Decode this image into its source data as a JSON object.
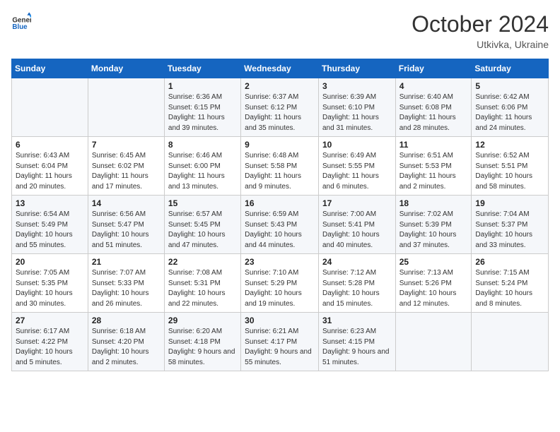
{
  "header": {
    "logo_general": "General",
    "logo_blue": "Blue",
    "month": "October 2024",
    "location": "Utkivka, Ukraine"
  },
  "days_of_week": [
    "Sunday",
    "Monday",
    "Tuesday",
    "Wednesday",
    "Thursday",
    "Friday",
    "Saturday"
  ],
  "weeks": [
    [
      {
        "day": "",
        "info": ""
      },
      {
        "day": "",
        "info": ""
      },
      {
        "day": "1",
        "info": "Sunrise: 6:36 AM\nSunset: 6:15 PM\nDaylight: 11 hours and 39 minutes."
      },
      {
        "day": "2",
        "info": "Sunrise: 6:37 AM\nSunset: 6:12 PM\nDaylight: 11 hours and 35 minutes."
      },
      {
        "day": "3",
        "info": "Sunrise: 6:39 AM\nSunset: 6:10 PM\nDaylight: 11 hours and 31 minutes."
      },
      {
        "day": "4",
        "info": "Sunrise: 6:40 AM\nSunset: 6:08 PM\nDaylight: 11 hours and 28 minutes."
      },
      {
        "day": "5",
        "info": "Sunrise: 6:42 AM\nSunset: 6:06 PM\nDaylight: 11 hours and 24 minutes."
      }
    ],
    [
      {
        "day": "6",
        "info": "Sunrise: 6:43 AM\nSunset: 6:04 PM\nDaylight: 11 hours and 20 minutes."
      },
      {
        "day": "7",
        "info": "Sunrise: 6:45 AM\nSunset: 6:02 PM\nDaylight: 11 hours and 17 minutes."
      },
      {
        "day": "8",
        "info": "Sunrise: 6:46 AM\nSunset: 6:00 PM\nDaylight: 11 hours and 13 minutes."
      },
      {
        "day": "9",
        "info": "Sunrise: 6:48 AM\nSunset: 5:58 PM\nDaylight: 11 hours and 9 minutes."
      },
      {
        "day": "10",
        "info": "Sunrise: 6:49 AM\nSunset: 5:55 PM\nDaylight: 11 hours and 6 minutes."
      },
      {
        "day": "11",
        "info": "Sunrise: 6:51 AM\nSunset: 5:53 PM\nDaylight: 11 hours and 2 minutes."
      },
      {
        "day": "12",
        "info": "Sunrise: 6:52 AM\nSunset: 5:51 PM\nDaylight: 10 hours and 58 minutes."
      }
    ],
    [
      {
        "day": "13",
        "info": "Sunrise: 6:54 AM\nSunset: 5:49 PM\nDaylight: 10 hours and 55 minutes."
      },
      {
        "day": "14",
        "info": "Sunrise: 6:56 AM\nSunset: 5:47 PM\nDaylight: 10 hours and 51 minutes."
      },
      {
        "day": "15",
        "info": "Sunrise: 6:57 AM\nSunset: 5:45 PM\nDaylight: 10 hours and 47 minutes."
      },
      {
        "day": "16",
        "info": "Sunrise: 6:59 AM\nSunset: 5:43 PM\nDaylight: 10 hours and 44 minutes."
      },
      {
        "day": "17",
        "info": "Sunrise: 7:00 AM\nSunset: 5:41 PM\nDaylight: 10 hours and 40 minutes."
      },
      {
        "day": "18",
        "info": "Sunrise: 7:02 AM\nSunset: 5:39 PM\nDaylight: 10 hours and 37 minutes."
      },
      {
        "day": "19",
        "info": "Sunrise: 7:04 AM\nSunset: 5:37 PM\nDaylight: 10 hours and 33 minutes."
      }
    ],
    [
      {
        "day": "20",
        "info": "Sunrise: 7:05 AM\nSunset: 5:35 PM\nDaylight: 10 hours and 30 minutes."
      },
      {
        "day": "21",
        "info": "Sunrise: 7:07 AM\nSunset: 5:33 PM\nDaylight: 10 hours and 26 minutes."
      },
      {
        "day": "22",
        "info": "Sunrise: 7:08 AM\nSunset: 5:31 PM\nDaylight: 10 hours and 22 minutes."
      },
      {
        "day": "23",
        "info": "Sunrise: 7:10 AM\nSunset: 5:29 PM\nDaylight: 10 hours and 19 minutes."
      },
      {
        "day": "24",
        "info": "Sunrise: 7:12 AM\nSunset: 5:28 PM\nDaylight: 10 hours and 15 minutes."
      },
      {
        "day": "25",
        "info": "Sunrise: 7:13 AM\nSunset: 5:26 PM\nDaylight: 10 hours and 12 minutes."
      },
      {
        "day": "26",
        "info": "Sunrise: 7:15 AM\nSunset: 5:24 PM\nDaylight: 10 hours and 8 minutes."
      }
    ],
    [
      {
        "day": "27",
        "info": "Sunrise: 6:17 AM\nSunset: 4:22 PM\nDaylight: 10 hours and 5 minutes."
      },
      {
        "day": "28",
        "info": "Sunrise: 6:18 AM\nSunset: 4:20 PM\nDaylight: 10 hours and 2 minutes."
      },
      {
        "day": "29",
        "info": "Sunrise: 6:20 AM\nSunset: 4:18 PM\nDaylight: 9 hours and 58 minutes."
      },
      {
        "day": "30",
        "info": "Sunrise: 6:21 AM\nSunset: 4:17 PM\nDaylight: 9 hours and 55 minutes."
      },
      {
        "day": "31",
        "info": "Sunrise: 6:23 AM\nSunset: 4:15 PM\nDaylight: 9 hours and 51 minutes."
      },
      {
        "day": "",
        "info": ""
      },
      {
        "day": "",
        "info": ""
      }
    ]
  ]
}
